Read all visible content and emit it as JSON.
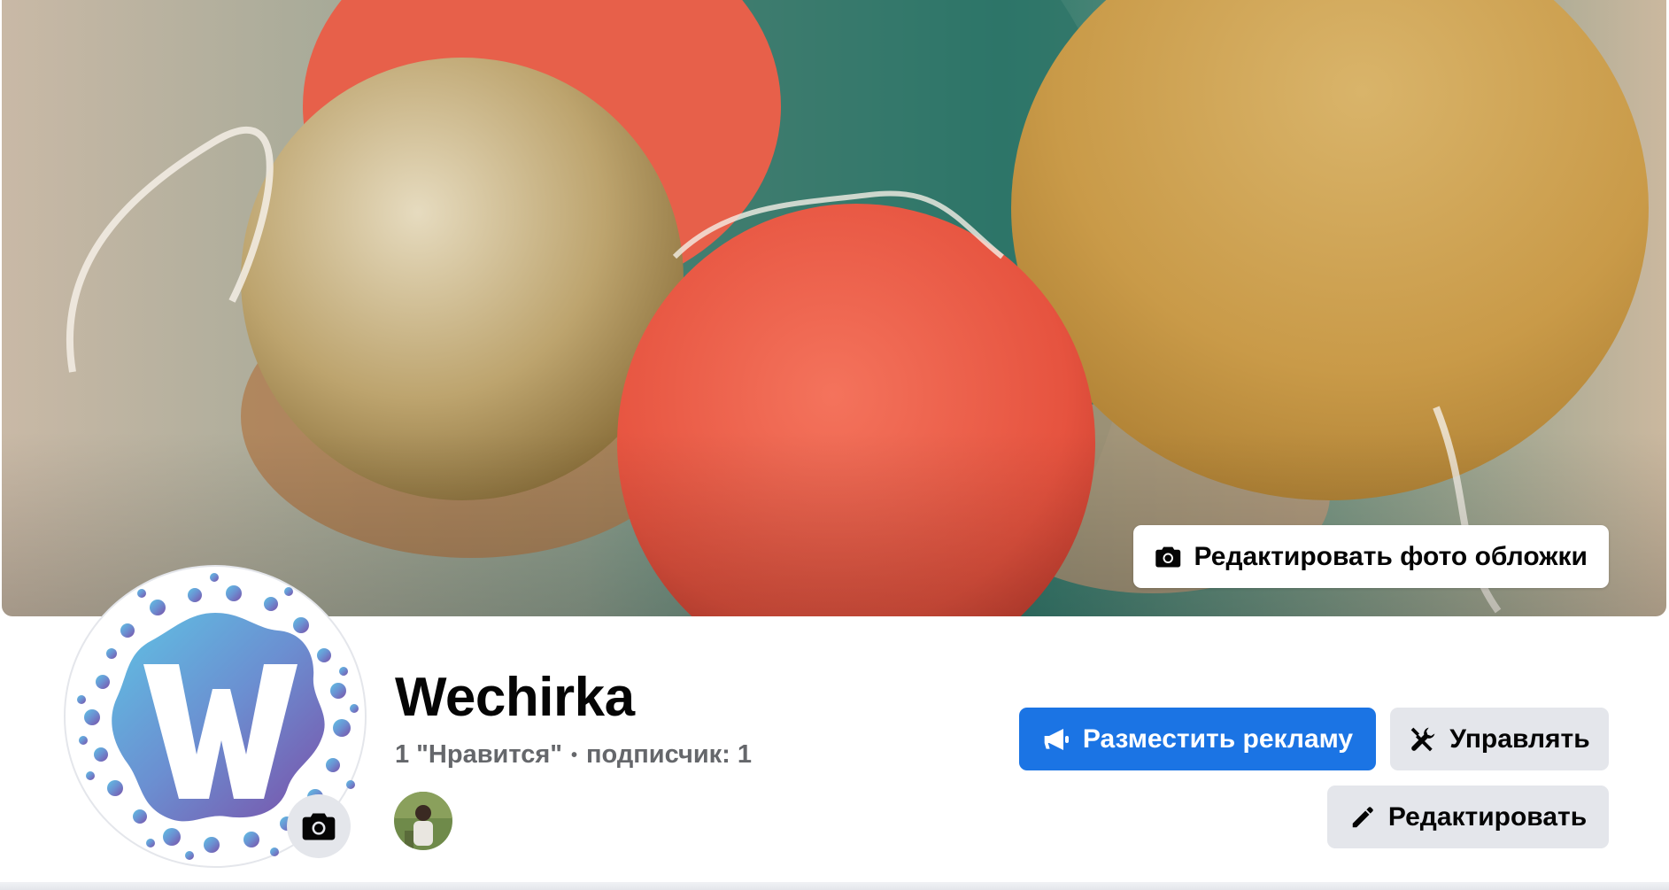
{
  "cover": {
    "edit_label": "Редактировать фото обложки",
    "colors": {
      "bg": "#6e8f7f",
      "coral": "#ec5f4b",
      "gold": "#cfa14f"
    }
  },
  "page": {
    "name": "Wechirka",
    "likes_text": "1 \"Нравится\"",
    "separator": "•",
    "followers_text": "подписчик: 1"
  },
  "actions": {
    "advertise_label": "Разместить рекламу",
    "manage_label": "Управлять",
    "edit_label": "Редактировать"
  },
  "icons": {
    "cover_camera": "camera-icon",
    "avatar_camera": "camera-icon",
    "advertise": "megaphone-icon",
    "manage": "tools-icon",
    "edit": "pencil-icon"
  },
  "theme": {
    "accent": "#1b74e4",
    "secondary_button": "#e4e6eb",
    "text_primary": "#050505",
    "text_secondary": "#65676b"
  }
}
